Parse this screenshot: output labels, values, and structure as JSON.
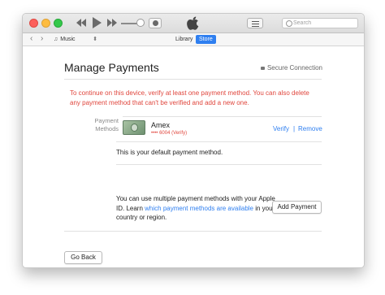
{
  "window": {
    "search": {
      "placeholder": "Search"
    }
  },
  "navbar": {
    "media": "Music",
    "tabs": [
      {
        "label": "Library",
        "selected": false
      },
      {
        "label": "Store",
        "selected": true
      }
    ]
  },
  "page": {
    "title": "Manage Payments",
    "secure": "Secure Connection",
    "warning": "To continue on this device, verify at least one payment method. You can also delete any payment method that can't be verified and add a new one.",
    "payment_methods_label_1": "Payment",
    "payment_methods_label_2": "Methods",
    "card": {
      "name": "Amex",
      "number": "•••• 6004 (Verify)"
    },
    "verify": "Verify",
    "separator": "|",
    "remove": "Remove",
    "default_text": "This is your default payment method.",
    "multi_text_1": "You can use multiple payment methods with your Apple ID. Learn ",
    "multi_link": "which payment methods are available",
    "multi_text_2": " in your country or region.",
    "add_button": "Add Payment",
    "go_back": "Go Back"
  },
  "colors": {
    "accent": "#2f7ff0",
    "warning": "#e0463d"
  }
}
